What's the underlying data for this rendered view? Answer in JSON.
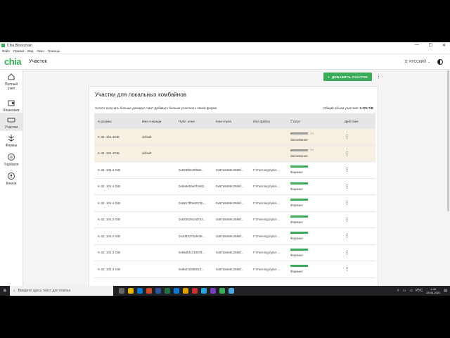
{
  "window": {
    "title": "Chia Blockchain",
    "controls": [
      "—",
      "☐",
      "✕"
    ]
  },
  "menu": [
    "Файл",
    "Правка",
    "Вид",
    "Окно",
    "Помощь"
  ],
  "app": {
    "logo": "chia",
    "page_title": "Участок",
    "language": "РУССКИЙ"
  },
  "sidebar": [
    {
      "label_1": "Полный",
      "label_2": "узел",
      "icon": "home-icon"
    },
    {
      "label_1": "Кошельки",
      "label_2": "",
      "icon": "wallet-icon"
    },
    {
      "label_1": "Участки",
      "label_2": "",
      "icon": "plots-icon"
    },
    {
      "label_1": "Фермы",
      "label_2": "",
      "icon": "farm-icon"
    },
    {
      "label_1": "Торговля",
      "label_2": "",
      "icon": "trade-icon"
    },
    {
      "label_1": "Ключи",
      "label_2": "",
      "icon": "keys-icon"
    }
  ],
  "actions": {
    "add_label": "ДОБАВИТЬ УЧАСТОК",
    "add_icon": "+"
  },
  "card": {
    "title": "Участки для локальных комбайнов",
    "hint": "Хотите получать больше дохода в Чиа? Добавьте больше участков к своей ферме.",
    "total_label": "Общий объем участков:",
    "total_value": "2.376 TiB"
  },
  "table": {
    "headers": [
      "K-размер",
      "Имя очереди",
      "Публ. ключ",
      "Ключ пула",
      "Имя файла",
      "Статус",
      "Действие"
    ],
    "rows": [
      {
        "k": "K-32, 101.4GiB",
        "queue": "default",
        "pub": "",
        "pool": "",
        "file": "",
        "status": "Засеивание",
        "progress": 0,
        "pct": "0%",
        "state": "plotting"
      },
      {
        "k": "K-32, 101.4GiB",
        "queue": "default",
        "pub": "",
        "pool": "",
        "file": "",
        "status": "Засеивание",
        "progress": 0,
        "pct": "0%",
        "state": "plotting"
      },
      {
        "k": "K-32, 101.4 GiB",
        "queue": "",
        "pub": "0x922f82c0f9d6...",
        "pool": "0x97a9469c2586f...",
        "file": "F:\\Farming1\\plot-...",
        "status": "Фарминг",
        "progress": 1,
        "pct": "",
        "state": "farming"
      },
      {
        "k": "K-32, 101.4 GiB",
        "queue": "",
        "pub": "0x8a8eb5e0f18d2...",
        "pool": "0x97a9469c2586f...",
        "file": "F:\\Farming1\\plot-...",
        "status": "Фарминг",
        "progress": 1,
        "pct": "",
        "state": "farming"
      },
      {
        "k": "K-32, 101.4 GiB",
        "queue": "",
        "pub": "0x6817ff0e8072b...",
        "pool": "0x97a9469c2586f...",
        "file": "F:\\Farming1\\plot-...",
        "status": "Фарминг",
        "progress": 1,
        "pct": "",
        "state": "farming"
      },
      {
        "k": "K-32, 101.3 GiB",
        "queue": "",
        "pub": "0x82b62910d724...",
        "pool": "0x97a9469c2586f...",
        "file": "F:\\Farming1\\plot-...",
        "status": "Фарминг",
        "progress": 1,
        "pct": "",
        "state": "farming"
      },
      {
        "k": "K-32, 101.4 GiB",
        "queue": "",
        "pub": "0x2d03373afe39...",
        "pool": "0x97a9469c2586f...",
        "file": "F:\\Farming1\\plot-...",
        "status": "Фарминг",
        "progress": 1,
        "pct": "",
        "state": "farming"
      },
      {
        "k": "K-32, 101.3 GiB",
        "queue": "",
        "pub": "0x86dbf1318078...",
        "pool": "0x97a9469c2586f...",
        "file": "F:\\Farming1\\plot-...",
        "status": "Фарминг",
        "progress": 1,
        "pct": "",
        "state": "farming"
      },
      {
        "k": "K-32, 101.4 GiB",
        "queue": "",
        "pub": "0x9b018488013...",
        "pool": "0x97a9469c2586f...",
        "file": "F:\\Farming1\\plot-...",
        "status": "Фарминг",
        "progress": 1,
        "pct": "",
        "state": "farming"
      }
    ]
  },
  "colors": {
    "accent": "#3aac59",
    "plotting_bar": "#9a9a9a",
    "plotting_row": "#f7f0e0"
  },
  "taskbar": {
    "search_placeholder": "Введите здесь текст для поиска",
    "lang": "РУС",
    "time": "1:40",
    "date": "28.04.2021"
  }
}
